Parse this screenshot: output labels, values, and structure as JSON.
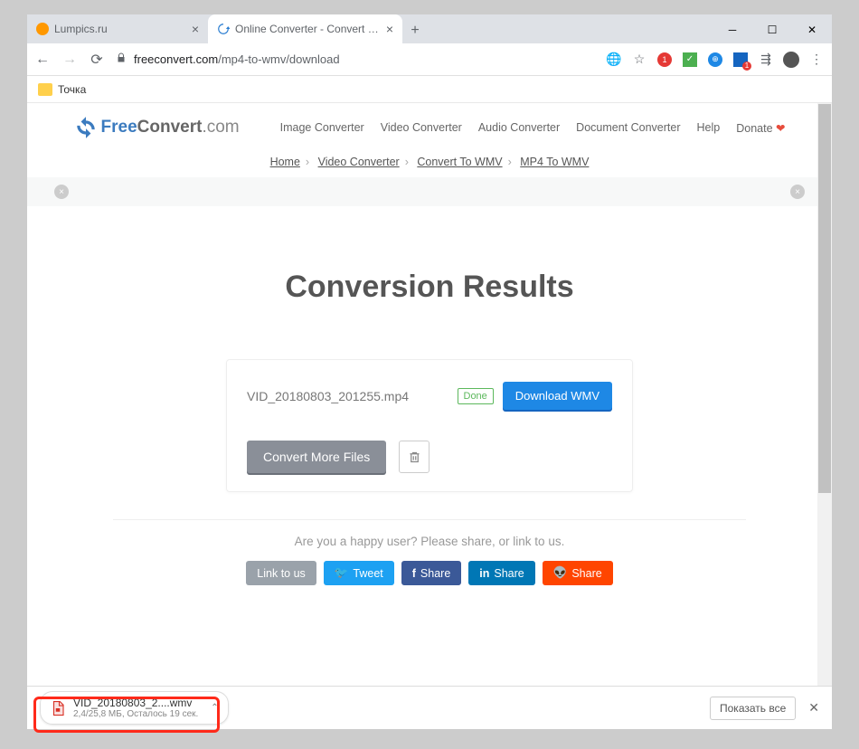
{
  "tabs": [
    {
      "title": "Lumpics.ru"
    },
    {
      "title": "Online Converter - Convert Imag"
    }
  ],
  "url": {
    "host": "freeconvert.com",
    "path": "/mp4-to-wmv/download"
  },
  "bookmark": {
    "label": "Точка"
  },
  "logo": {
    "free": "Free",
    "convert": "Convert",
    "dot": ".com"
  },
  "nav": {
    "image": "Image Converter",
    "video": "Video Converter",
    "audio": "Audio Converter",
    "document": "Document Converter",
    "help": "Help",
    "donate": "Donate"
  },
  "crumbs": {
    "home": "Home",
    "video": "Video Converter",
    "cwmv": "Convert To WMV",
    "mp4wmv": "MP4 To WMV"
  },
  "heading": "Conversion Results",
  "file": {
    "name": "VID_20180803_201255.mp4",
    "status": "Done",
    "download": "Download WMV"
  },
  "more": "Convert More Files",
  "share": {
    "prompt": "Are you a happy user? Please share, or link to us.",
    "link": "Link to us",
    "tweet": "Tweet",
    "fb": "Share",
    "in": "Share",
    "rd": "Share"
  },
  "download": {
    "filename": "VID_20180803_2....wmv",
    "status": "2,4/25,8 МБ, Осталось 19 сек."
  },
  "dlbar": {
    "showall": "Показать все"
  }
}
